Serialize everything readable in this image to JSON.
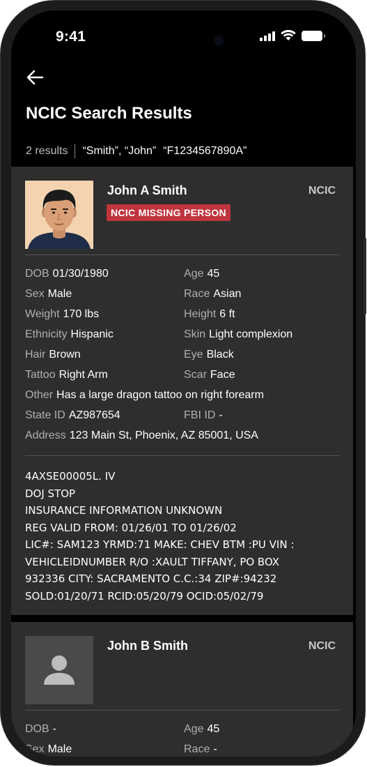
{
  "status_bar": {
    "time": "9:41"
  },
  "header": {
    "title": "NCIC Search Results"
  },
  "summary": {
    "count": "2 results",
    "queries": [
      "“Smith”, “John”",
      "“F1234567890A”"
    ]
  },
  "records": [
    {
      "name": "John A Smith",
      "source": "NCIC",
      "badge": "NCIC MISSING PERSON",
      "badge_color": "#c0343d",
      "fields": {
        "dob": {
          "label": "DOB",
          "value": "01/30/1980"
        },
        "age": {
          "label": "Age",
          "value": "45"
        },
        "sex": {
          "label": "Sex",
          "value": "Male"
        },
        "race": {
          "label": "Race",
          "value": "Asian"
        },
        "weight": {
          "label": "Weight",
          "value": "170 lbs"
        },
        "height": {
          "label": "Height",
          "value": "6 ft"
        },
        "ethnicity": {
          "label": "Ethnicity",
          "value": "Hispanic"
        },
        "skin": {
          "label": "Skin",
          "value": "Light complexion"
        },
        "hair": {
          "label": "Hair",
          "value": "Brown"
        },
        "eye": {
          "label": "Eye",
          "value": "Black"
        },
        "tattoo": {
          "label": "Tattoo",
          "value": "Right Arm"
        },
        "scar": {
          "label": "Scar",
          "value": "Face"
        },
        "other": {
          "label": "Other",
          "value": "Has a large dragon tattoo on right forearm"
        },
        "state_id": {
          "label": "State ID",
          "value": "AZ987654"
        },
        "fbi_id": {
          "label": "FBI ID",
          "value": "-"
        },
        "address": {
          "label": "Address",
          "value": "123 Main St, Phoenix, AZ 85001, USA"
        }
      },
      "narrative": [
        "4AXSE00005L. IV",
        "DOJ STOP",
        "INSURANCE INFORMATION UNKNOWN",
        "REG VALID FROM: 01/26/01 TO 01/26/02",
        "LIC#: SAM123 YRMD:71 MAKE: CHEV BTM :PU VIN :",
        "VEHICLEIDNUMBER R/O :XAULT TIFFANY, PO BOX",
        "932336 CITY: SACRAMENTO C.C.:34 ZIP#:94232",
        "SOLD:01/20/71 RCID:05/20/79 OCID:05/02/79"
      ]
    },
    {
      "name": "John B Smith",
      "source": "NCIC",
      "fields": {
        "dob": {
          "label": "DOB",
          "value": "-"
        },
        "age": {
          "label": "Age",
          "value": "45"
        },
        "sex": {
          "label": "Sex",
          "value": "Male"
        },
        "race": {
          "label": "Race",
          "value": "-"
        }
      }
    }
  ],
  "icons": {
    "back": "arrow-left-icon",
    "person_placeholder": "person-icon",
    "signal": "cellular-signal-icon",
    "wifi": "wifi-icon",
    "battery": "battery-icon"
  },
  "colors": {
    "background": "#000000",
    "card": "#2e2e2e",
    "label": "#b0b0b0",
    "value": "#ffffff"
  }
}
